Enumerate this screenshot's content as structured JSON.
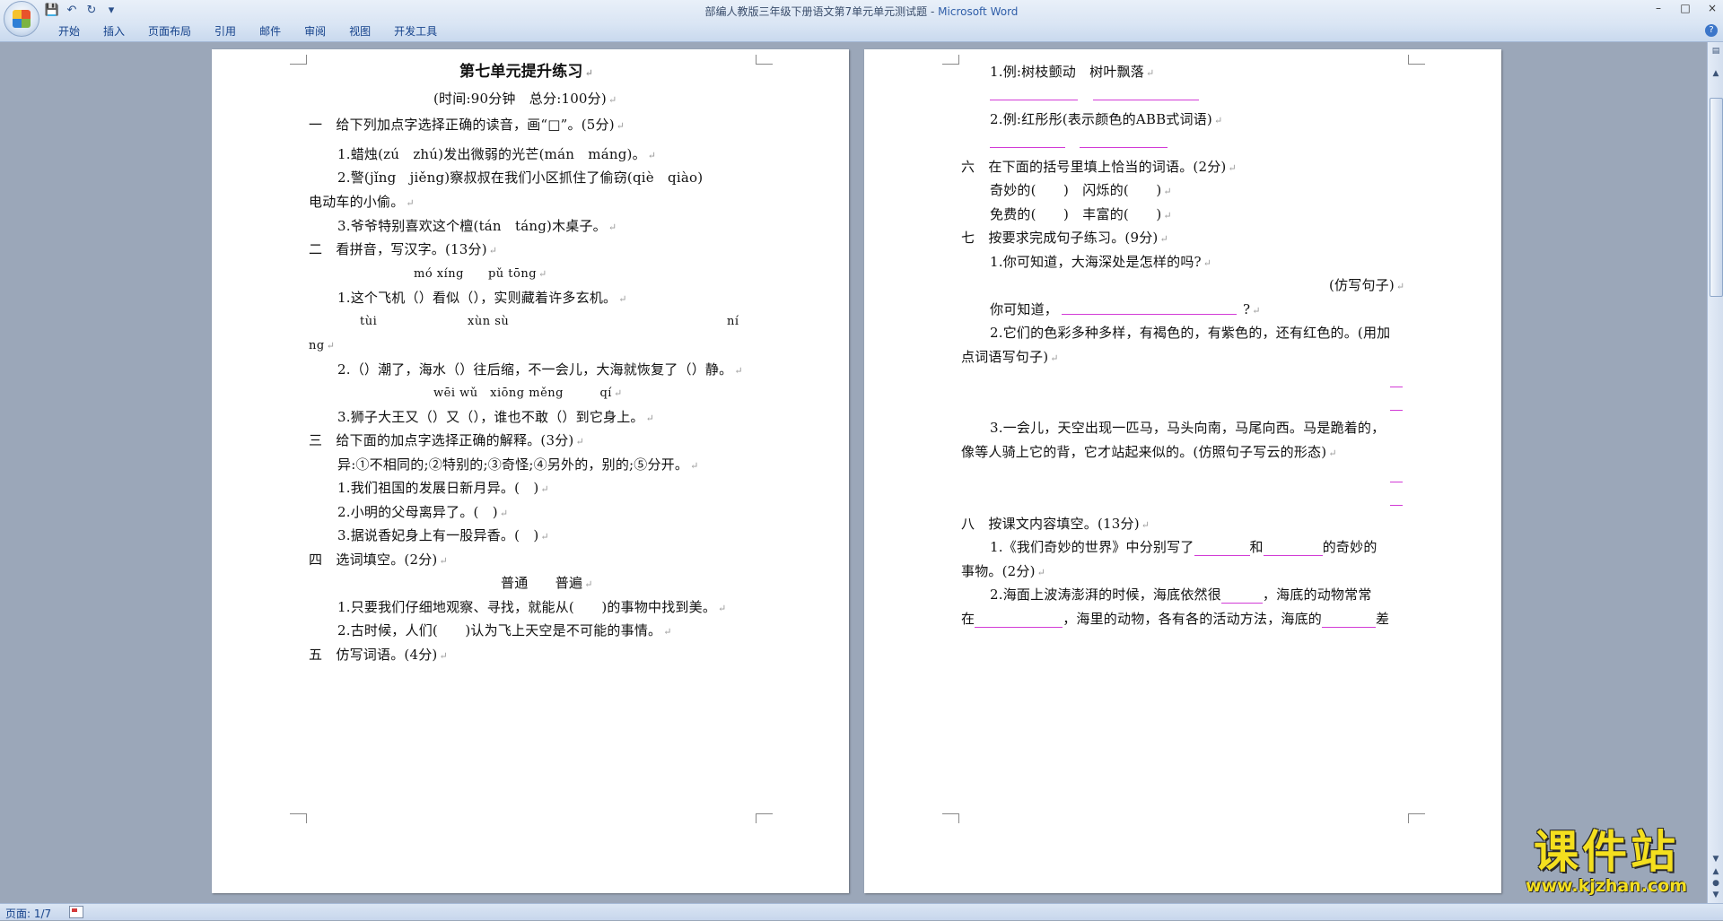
{
  "window": {
    "title_doc": "部编人教版三年级下册语文第7单元单元测试题",
    "title_sep": " - ",
    "title_app": "Microsoft Word"
  },
  "qat": {
    "save_icon": "💾",
    "undo_icon": "↶",
    "redo_icon": "↻",
    "more_icon": "▾"
  },
  "ribbon": {
    "tabs": [
      "开始",
      "插入",
      "页面布局",
      "引用",
      "邮件",
      "审阅",
      "视图",
      "开发工具"
    ],
    "help_icon": "?"
  },
  "page_left": {
    "title": "第七单元提升练习",
    "subtitle": "(时间:90分钟　总分:100分)",
    "lines": [
      "一　给下列加点字选择正确的读音，画“□”。(5分)",
      "1.蜡烛(zú　zhú)发出微弱的光芒(mán　máng)。",
      "2.警(jǐng　jiěng)察叔叔在我们小区抓住了偷窃(qiè　qiào)",
      "电动车的小偷。",
      "3.爷爷特别喜欢这个檀(tán　táng)木桌子。",
      "二　看拼音，写汉字。(13分)",
      "mó xíng　　pǔ tōng",
      "1.这个飞机（）看似（），实则藏着许多玄机。",
      "tùi",
      "xùn sù",
      "ní",
      "ng",
      "2.（）潮了，海水（）往后缩，不一会儿，大海就恢复了（）静。",
      "wēi wǔ　xiōng měng　　　qí",
      "3.狮子大王又（）又（），谁也不敢（）到它身上。",
      "三　给下面的加点字选择正确的解释。(3分)",
      "异:①不相同的;②特别的;③奇怪;④另外的，别的;⑤分开。",
      "1.我们祖国的发展日新月异。(　)",
      "2.小明的父母离异了。(　)",
      "3.据说香妃身上有一股异香。(　)",
      "四　选词填空。(2分)",
      "普通　　普遍",
      "1.只要我们仔细地观察、寻找，就能从(　　)的事物中找到美。",
      "2.古时候，人们(　　)认为飞上天空是不可能的事情。",
      "五　仿写词语。(4分)"
    ]
  },
  "page_right": {
    "lines": [
      "1.例:树枝颤动　树叶飘落",
      "2.例:红彤彤(表示颜色的ABB式词语)",
      "六　在下面的括号里填上恰当的词语。(2分)",
      "奇妙的(　　)　闪烁的(　　)",
      "免费的(　　)　丰富的(　　)",
      "七　按要求完成句子练习。(9分)",
      "1.你可知道，大海深处是怎样的吗?",
      "(仿写句子)",
      "你可知道，",
      "?",
      "2.它们的色彩多种多样，有褐色的，有紫色的，还有红色的。(用加",
      "点词语写句子)",
      "3.一会儿，天空出现一匹马，马头向南，马尾向西。马是跪着的，",
      "像等人骑上它的背，它才站起来似的。(仿照句子写云的形态)",
      "八　按课文内容填空。(13分)",
      "1.《我们奇妙的世界》中分别写了",
      "和",
      "的奇妙的",
      "事物。(2分)",
      "2.海面上波涛澎湃的时候，海底依然很",
      "，海底的动物常常",
      "在",
      "，海里的动物，各有各的活动方法，海底的",
      "差"
    ]
  },
  "return_mark": "↵",
  "statusbar": {
    "page_count": "页面: 1/7"
  },
  "watermark": {
    "main": "课件站",
    "url": "www.kjzhan.com"
  },
  "colors": {
    "blank_underline": "#d23bd6",
    "watermark": "#f4df1e",
    "ribbon_text": "#15428b"
  }
}
